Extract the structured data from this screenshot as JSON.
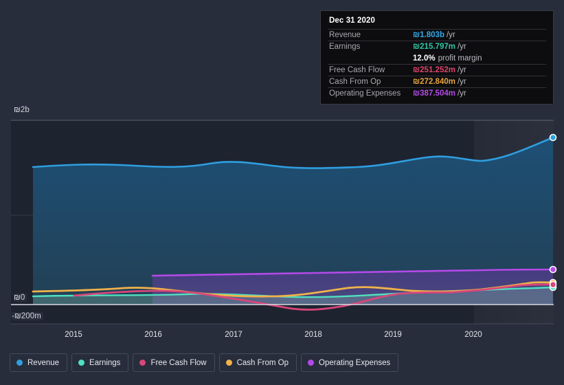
{
  "axes": {
    "y_ticks": [
      "₪2b",
      "₪0",
      "-₪200m"
    ],
    "x_ticks": [
      "2015",
      "2016",
      "2017",
      "2018",
      "2019",
      "2020"
    ]
  },
  "tooltip": {
    "date": "Dec 31 2020",
    "rows": [
      {
        "label": "Revenue",
        "value": "₪1.803b",
        "unit": "/yr",
        "color": "#35a9e8"
      },
      {
        "label": "Earnings",
        "value": "₪215.797m",
        "unit": "/yr",
        "color": "#2fc6a8"
      },
      {
        "label": "Free Cash Flow",
        "value": "₪251.252m",
        "unit": "/yr",
        "color": "#e0446e"
      },
      {
        "label": "Cash From Op",
        "value": "₪272.840m",
        "unit": "/yr",
        "color": "#e8a33c"
      },
      {
        "label": "Operating Expenses",
        "value": "₪387.504m",
        "unit": "/yr",
        "color": "#b44ae8"
      }
    ],
    "margin_value": "12.0%",
    "margin_label": "profit margin"
  },
  "legend": [
    {
      "label": "Revenue",
      "color": "#2f9fe0"
    },
    {
      "label": "Earnings",
      "color": "#4fe0c0"
    },
    {
      "label": "Free Cash Flow",
      "color": "#d8467a"
    },
    {
      "label": "Cash From Op",
      "color": "#f0b24a"
    },
    {
      "label": "Operating Expenses",
      "color": "#b44ae8"
    }
  ],
  "chart_data": {
    "type": "area",
    "title": "",
    "xlabel": "",
    "ylabel": "",
    "currency": "ILS (₪)",
    "ylim": [
      -200000000,
      2000000000
    ],
    "y_gridlines": [
      2000000000,
      800000000,
      0,
      -200000000
    ],
    "x_range": [
      "2014-07",
      "2020-12"
    ],
    "grid": true,
    "legend_position": "bottom",
    "highlight_band": {
      "from": "2020-06",
      "to": "2020-12"
    },
    "series": [
      {
        "name": "Revenue",
        "color": "#2f9fe0",
        "x": [
          "2014-09",
          "2015-03",
          "2015-09",
          "2016-03",
          "2016-09",
          "2017-03",
          "2017-09",
          "2018-03",
          "2018-09",
          "2019-03",
          "2019-09",
          "2020-03",
          "2020-09",
          "2020-12"
        ],
        "values": [
          1315000000,
          1330000000,
          1300000000,
          1320000000,
          1360000000,
          1330000000,
          1325000000,
          1390000000,
          1355000000,
          1380000000,
          1450000000,
          1520000000,
          1680000000,
          1803000000
        ]
      },
      {
        "name": "Earnings",
        "color": "#4fe0c0",
        "x": [
          "2014-09",
          "2015-03",
          "2015-09",
          "2016-03",
          "2016-09",
          "2017-03",
          "2017-09",
          "2018-03",
          "2018-09",
          "2019-03",
          "2019-09",
          "2020-03",
          "2020-09",
          "2020-12"
        ],
        "values": [
          88000000,
          90000000,
          92000000,
          100000000,
          118000000,
          112000000,
          105000000,
          118000000,
          140000000,
          150000000,
          160000000,
          175000000,
          200000000,
          215797000
        ]
      },
      {
        "name": "Free Cash Flow",
        "color": "#d8467a",
        "x": [
          "2015-06",
          "2015-09",
          "2016-03",
          "2016-09",
          "2017-03",
          "2017-09",
          "2018-03",
          "2018-09",
          "2019-03",
          "2019-09",
          "2020-03",
          "2020-09",
          "2020-12"
        ],
        "values": [
          105000000,
          130000000,
          60000000,
          95000000,
          150000000,
          60000000,
          -30000000,
          15000000,
          110000000,
          135000000,
          150000000,
          215000000,
          251252000
        ]
      },
      {
        "name": "Cash From Op",
        "color": "#f0b24a",
        "x": [
          "2014-09",
          "2015-03",
          "2015-09",
          "2016-03",
          "2016-09",
          "2017-03",
          "2017-09",
          "2018-03",
          "2018-09",
          "2019-03",
          "2019-09",
          "2020-03",
          "2020-09",
          "2020-12"
        ],
        "values": [
          145000000,
          150000000,
          155000000,
          175000000,
          140000000,
          160000000,
          175000000,
          135000000,
          140000000,
          150000000,
          160000000,
          175000000,
          240000000,
          272840000
        ]
      },
      {
        "name": "Operating Expenses",
        "color": "#b44ae8",
        "x": [
          "2016-01",
          "2016-09",
          "2017-03",
          "2017-09",
          "2018-03",
          "2018-09",
          "2019-03",
          "2019-09",
          "2020-03",
          "2020-09",
          "2020-12"
        ],
        "values": [
          330000000,
          332000000,
          335000000,
          338000000,
          342000000,
          348000000,
          355000000,
          362000000,
          370000000,
          380000000,
          387504000
        ]
      }
    ]
  }
}
